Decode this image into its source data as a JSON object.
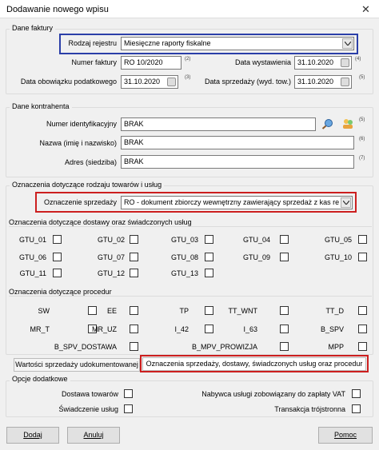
{
  "window": {
    "title": "Dodawanie nowego wpisu",
    "close_glyph": "✕"
  },
  "invoice": {
    "section": "Dane faktury",
    "register_label": "Rodzaj rejestru",
    "register_value": "Miesięczne raporty fiskalne",
    "number_label": "Numer faktury",
    "number_value": "RO 10/2020",
    "number_note": "(2)",
    "issue_label": "Data wystawienia",
    "issue_value": "31.10.2020",
    "issue_note": "(4)",
    "tax_label": "Data obowiązku podatkowego",
    "tax_value": "31.10.2020",
    "tax_note": "(3)",
    "sale_label": "Data sprzedaży (wyd. tow.)",
    "sale_value": "31.10.2020",
    "sale_note": "(5)"
  },
  "contractor": {
    "section": "Dane kontrahenta",
    "id_label": "Numer identyfikacyjny",
    "id_value": "BRAK",
    "id_note": "(5)",
    "name_label": "Nazwa (imię i nazwisko)",
    "name_value": "BRAK",
    "name_note": "(6)",
    "address_label": "Adres (siedziba)",
    "address_value": "BRAK",
    "address_note": "(7)"
  },
  "goods": {
    "section": "Oznaczenia dotyczące rodzaju towarów i usług",
    "sale_mark_label": "Oznaczenie sprzedaży",
    "sale_mark_value": "RO - dokument zbiorczy wewnętrzny zawierający sprzedaż z kas re",
    "gtu_section": "Oznaczenia dotyczące dostawy oraz świadczonych usług",
    "gtu": [
      "GTU_01",
      "GTU_02",
      "GTU_03",
      "GTU_04",
      "GTU_05",
      "GTU_06",
      "GTU_07",
      "GTU_08",
      "GTU_09",
      "GTU_10",
      "GTU_11",
      "GTU_12",
      "GTU_13"
    ],
    "proc_section": "Oznaczenia dotyczące procedur",
    "proc": [
      "SW",
      "EE",
      "TP",
      "TT_WNT",
      "TT_D",
      "MR_T",
      "MR_UZ",
      "I_42",
      "I_63",
      "B_SPV",
      "B_SPV_DOSTAWA",
      "B_MPV_PROWIZJA",
      "MPP"
    ]
  },
  "tabs": {
    "tab1": "Wartości sprzedaży udokumentowanej",
    "tab2": "Oznaczenia sprzedaży, dostawy, świadczonych usług oraz procedur"
  },
  "extra": {
    "section": "Opcje dodatkowe",
    "delivery": "Dostawa towarów",
    "services": "Świadczenie usług",
    "buyer": "Nabywca usługi zobowiązany do zapłaty VAT",
    "triangular": "Transakcja trójstronna"
  },
  "buttons": {
    "add": "Dodaj",
    "cancel": "Anuluj",
    "help": "Pomoc"
  },
  "colors": {
    "highlight_blue": "#2b3fa8",
    "highlight_red": "#cc1f1f"
  }
}
